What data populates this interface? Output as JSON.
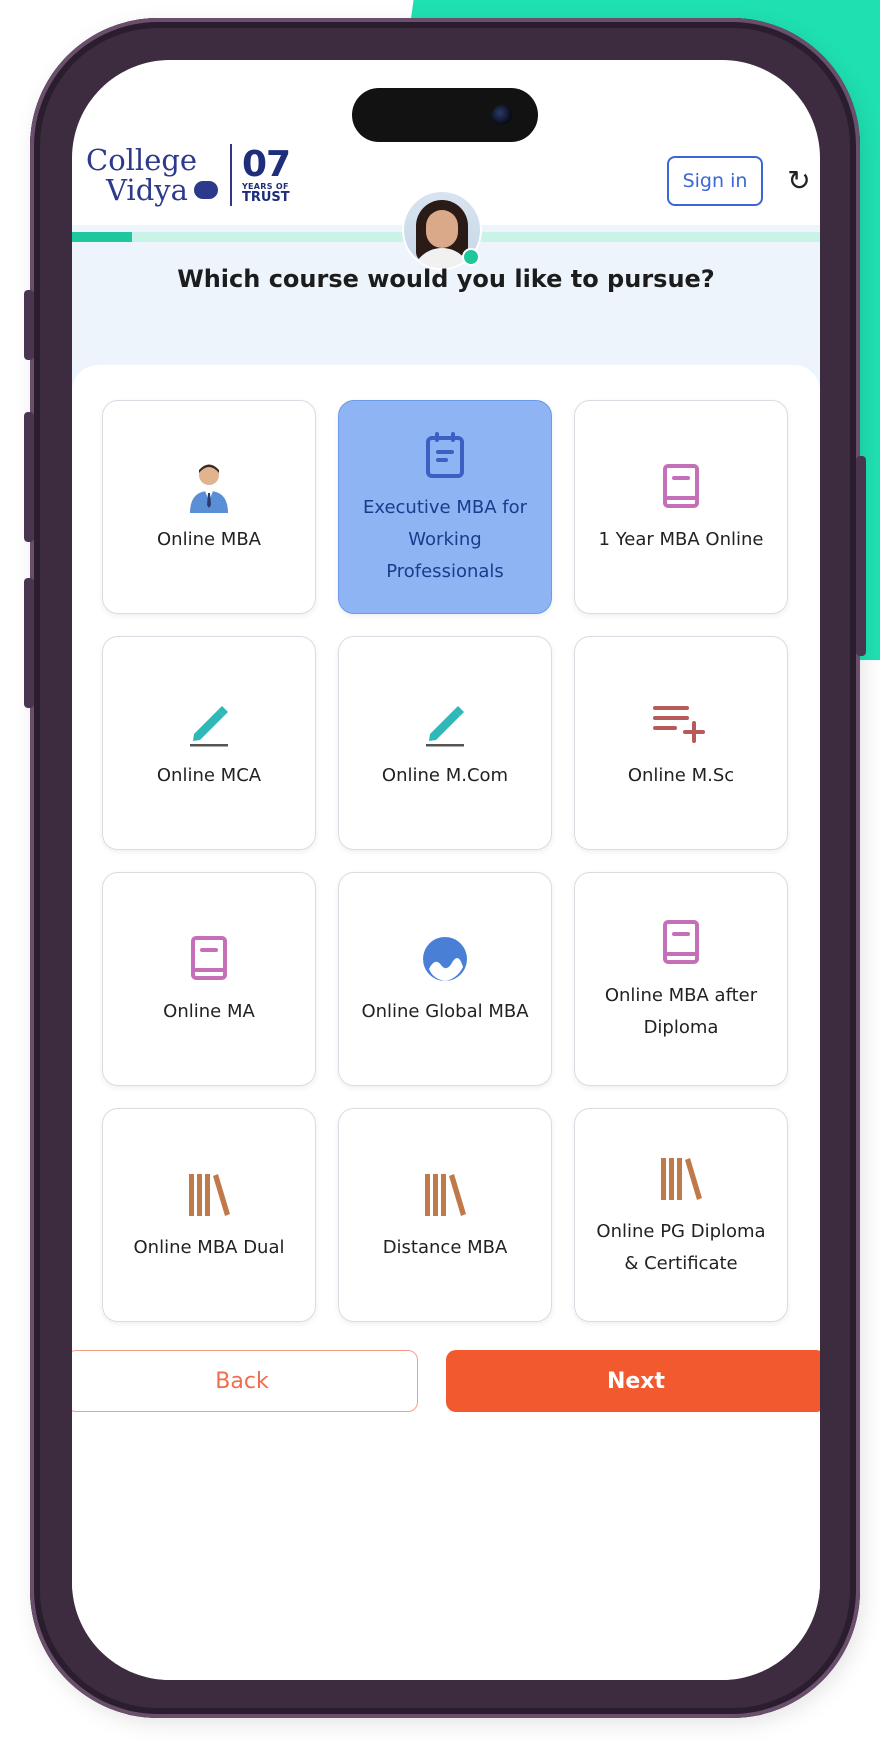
{
  "brand": {
    "name_line1": "College",
    "name_line2": "Vidya",
    "years_number": "07",
    "years_sub": "YEARS OF",
    "years_trust": "TRUST"
  },
  "header": {
    "signin_label": "Sign in",
    "refresh_icon": "refresh-icon"
  },
  "progress": {
    "fraction": 0.08,
    "color": "#1fc79c"
  },
  "question": "Which course would you like to pursue?",
  "courses": [
    {
      "label": "Online MBA",
      "icon": "businessman-icon",
      "selected": false
    },
    {
      "label": "Executive MBA for Working Professionals",
      "icon": "calendar-note-icon",
      "selected": true
    },
    {
      "label": "1 Year MBA Online",
      "icon": "book-icon",
      "selected": false
    },
    {
      "label": "Online MCA",
      "icon": "pencil-icon",
      "selected": false
    },
    {
      "label": "Online M.Com",
      "icon": "pencil-icon",
      "selected": false
    },
    {
      "label": "Online M.Sc",
      "icon": "list-add-icon",
      "selected": false
    },
    {
      "label": "Online MA",
      "icon": "book-icon",
      "selected": false
    },
    {
      "label": "Online Global MBA",
      "icon": "globe-icon",
      "selected": false
    },
    {
      "label": "Online MBA after Diploma",
      "icon": "book-icon",
      "selected": false
    },
    {
      "label": "Online MBA Dual",
      "icon": "library-books-icon",
      "selected": false
    },
    {
      "label": "Distance MBA",
      "icon": "library-books-icon",
      "selected": false
    },
    {
      "label": "Online PG Diploma & Certificate",
      "icon": "library-books-icon",
      "selected": false
    }
  ],
  "actions": {
    "back_label": "Back",
    "next_label": "Next"
  },
  "colors": {
    "accent_teal": "#1fe0b1",
    "brand_blue": "#2d3a8c",
    "selected_card": "#8eb4f4",
    "next_orange": "#f2592e"
  }
}
